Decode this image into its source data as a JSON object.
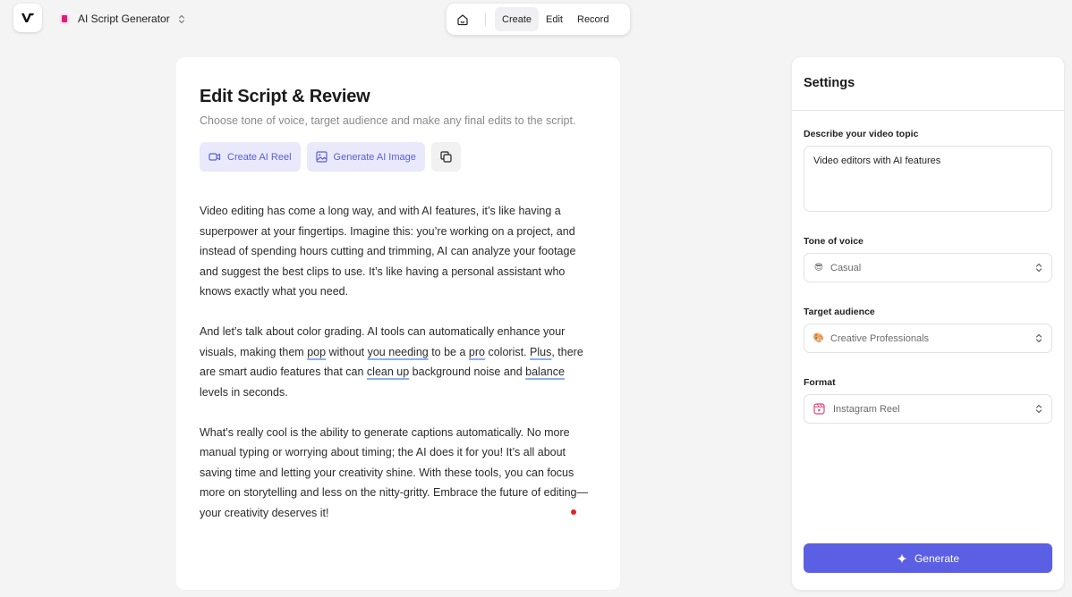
{
  "app": {
    "logo_letter": "V",
    "project_name": "AI Script Generator"
  },
  "nav": {
    "tabs": [
      {
        "label": "Create",
        "active": true
      },
      {
        "label": "Edit",
        "active": false
      },
      {
        "label": "Record",
        "active": false
      }
    ]
  },
  "editor": {
    "title": "Edit Script & Review",
    "subtitle": "Choose tone of voice, target audience and make any final edits to the script.",
    "buttons": {
      "create_reel": "Create AI Reel",
      "generate_image": "Generate AI Image"
    },
    "paragraphs": [
      "Video editing has come a long way, and with AI features, it’s like having a superpower at your fingertips. Imagine this: you’re working on a project, and instead of spending hours cutting and trimming, AI can analyze your footage and suggest the best clips to use. It’s like having a personal assistant who knows exactly what you need.",
      "And let’s talk about color grading. AI tools can automatically enhance your visuals, making them pop without you needing to be a pro colorist. Plus, there are smart audio features that can clean up background noise and balance levels in seconds.",
      "What’s really cool is the ability to generate captions automatically. No more manual typing or worrying about timing; the AI does it for you! It’s all about saving time and letting your creativity shine. With these tools, you can focus more on storytelling and less on the nitty-gritty. Embrace the future of editing—your creativity deserves it!"
    ],
    "p2_segments": {
      "a": "And let’s talk about color grading. AI tools can automatically enhance your visuals, making them ",
      "w1": "pop",
      "b": " without ",
      "w2": "you needing",
      "c": " to be a ",
      "w3": "pro",
      "d": " colorist. ",
      "w4": "Plus",
      "e": ", there are smart audio features that can ",
      "w5": "clean up",
      "f": " background noise and ",
      "w6": "balance",
      "g": " levels in seconds."
    }
  },
  "settings": {
    "title": "Settings",
    "topic": {
      "label": "Describe your video topic",
      "value": "Video editors with AI features"
    },
    "tone": {
      "label": "Tone of voice",
      "value": "Casual",
      "emoji": "😎"
    },
    "audience": {
      "label": "Target audience",
      "value": "Creative Professionals",
      "emoji": "🎨"
    },
    "format": {
      "label": "Format",
      "value": "Instagram Reel"
    },
    "generate_label": "Generate"
  },
  "colors": {
    "accent": "#5b5fe3",
    "accent_soft_bg": "#e9e9fb",
    "accent_soft_text": "#5a5fd6",
    "spell_underline": "#8fb1f0",
    "record_dot": "#e02424",
    "page_bg": "#f4f4f5"
  }
}
